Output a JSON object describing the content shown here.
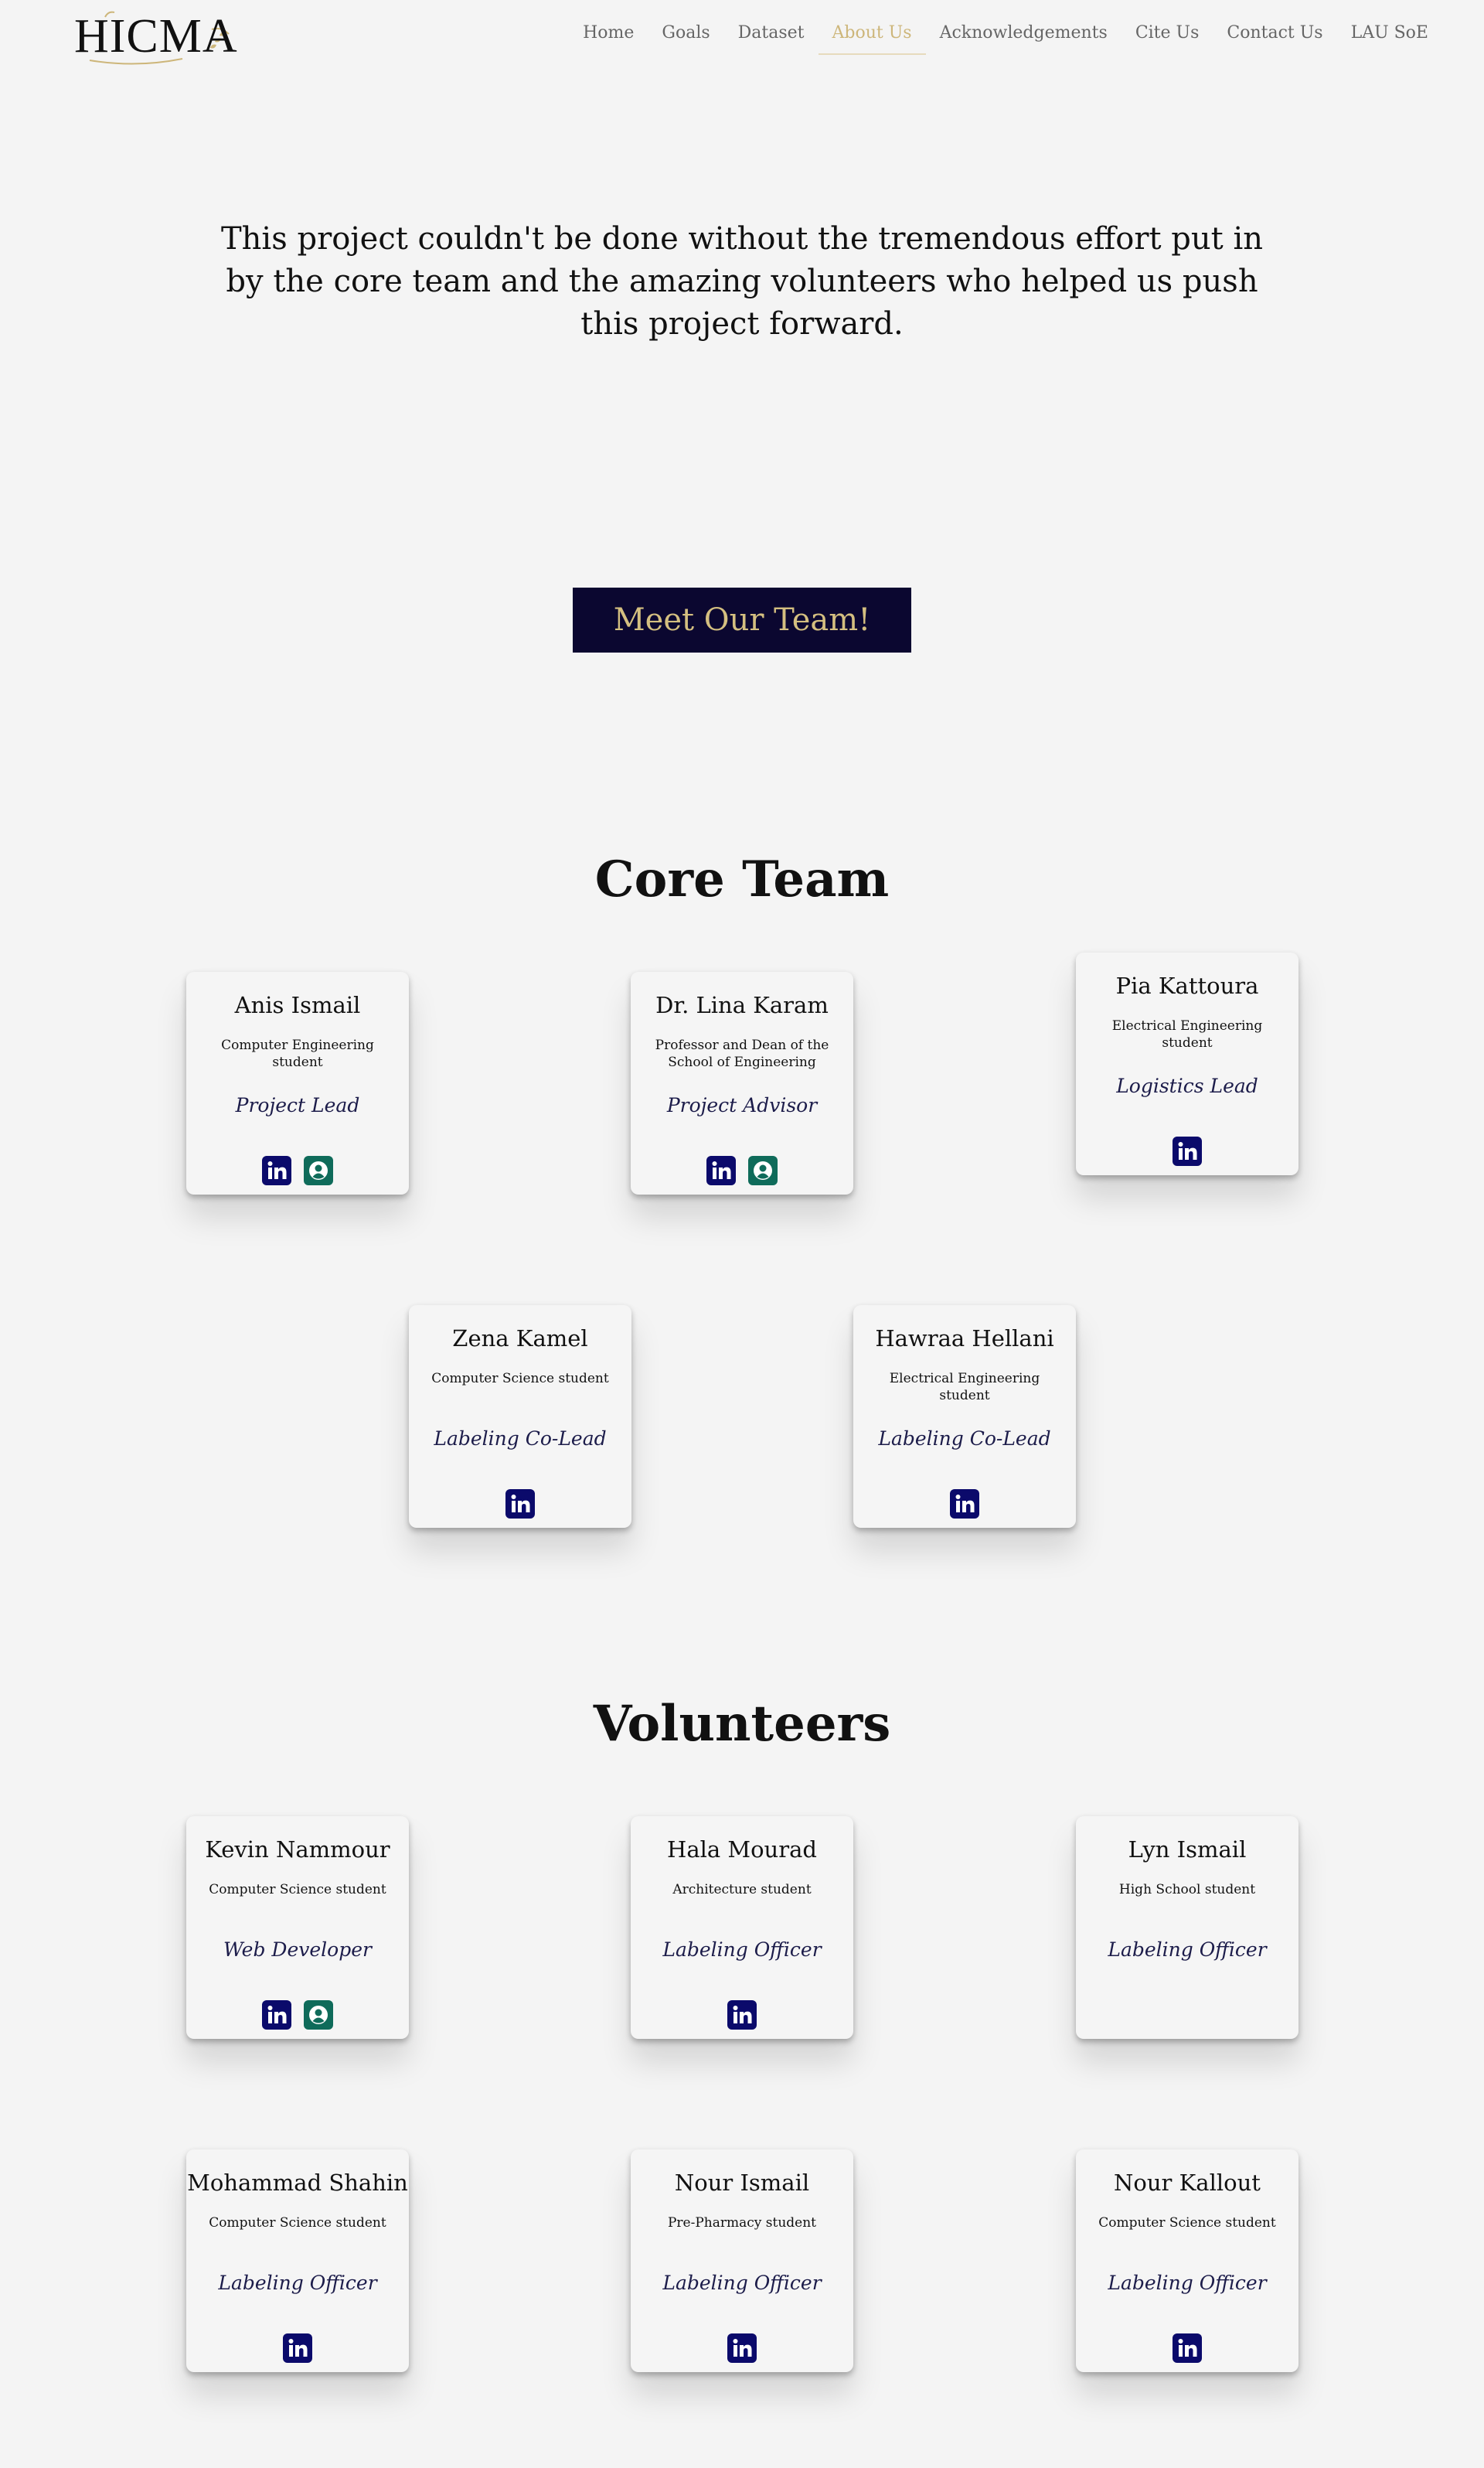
{
  "brand": {
    "logo_text": "HICMA"
  },
  "nav": {
    "items": [
      {
        "label": "Home"
      },
      {
        "label": "Goals"
      },
      {
        "label": "Dataset"
      },
      {
        "label": "About Us",
        "active": true
      },
      {
        "label": "Acknowledgements"
      },
      {
        "label": "Cite Us"
      },
      {
        "label": "Contact Us"
      },
      {
        "label": "LAU SoE"
      }
    ],
    "active_color": "#cdb67a"
  },
  "intro": {
    "text": "This project couldn't be done without the tremendous effort put in by the core team and the amazing volunteers who helped us push this project forward."
  },
  "cta": {
    "label": "Meet Our Team!",
    "bg_color": "#0b0730",
    "text_color": "#d4bf80"
  },
  "core_team": {
    "title": "Core Team",
    "members": [
      {
        "name": "Anis Ismail",
        "desc": "Computer Engineering student",
        "role": "Project Lead",
        "icons": [
          "linkedin-icon",
          "profile-icon"
        ]
      },
      {
        "name": "Dr. Lina Karam",
        "desc": "Professor and Dean of the School of Engineering",
        "role": "Project Advisor",
        "icons": [
          "linkedin-icon",
          "profile-icon"
        ]
      },
      {
        "name": "Pia Kattoura",
        "desc": "Electrical Engineering student",
        "role": "Logistics Lead",
        "icons": [
          "linkedin-icon"
        ]
      },
      {
        "name": "Zena Kamel",
        "desc": "Computer Science student",
        "role": "Labeling Co-Lead",
        "icons": [
          "linkedin-icon"
        ]
      },
      {
        "name": "Hawraa Hellani",
        "desc": "Electrical Engineering student",
        "role": "Labeling Co-Lead",
        "icons": [
          "linkedin-icon"
        ]
      }
    ]
  },
  "volunteers": {
    "title": "Volunteers",
    "members": [
      {
        "name": "Kevin Nammour",
        "desc": "Computer Science student",
        "role": "Web Developer",
        "icons": [
          "linkedin-icon",
          "profile-icon"
        ]
      },
      {
        "name": "Hala Mourad",
        "desc": "Architecture student",
        "role": "Labeling Officer",
        "icons": [
          "linkedin-icon"
        ]
      },
      {
        "name": "Lyn Ismail",
        "desc": "High School student",
        "role": "Labeling Officer",
        "icons": []
      },
      {
        "name": "Mohammad Shahin",
        "desc": "Computer Science student",
        "role": "Labeling Officer",
        "icons": [
          "linkedin-icon"
        ]
      },
      {
        "name": "Nour Ismail",
        "desc": "Pre-Pharmacy student",
        "role": "Labeling Officer",
        "icons": [
          "linkedin-icon"
        ]
      },
      {
        "name": "Nour Kallout",
        "desc": "Computer Science student",
        "role": "Labeling Officer",
        "icons": [
          "linkedin-icon"
        ]
      }
    ]
  },
  "colors": {
    "linkedin": "#0b0a6b",
    "profile": "#0f6b5a",
    "background": "#f4f4f4"
  }
}
